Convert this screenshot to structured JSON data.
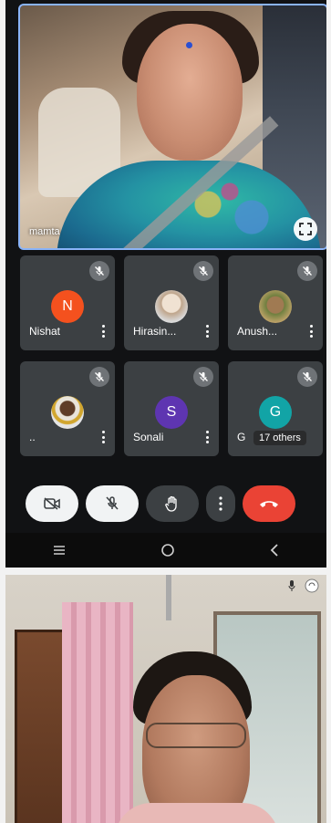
{
  "meeting": {
    "speaker": {
      "name": "mamta"
    },
    "participants": [
      {
        "name": "Nishat",
        "initial": "N",
        "avatar_type": "letter",
        "avatar_color": "#f4511e",
        "mic": "off"
      },
      {
        "name": "Hirasin...",
        "initial": "",
        "avatar_type": "photo1",
        "mic": "off"
      },
      {
        "name": "Anush...",
        "initial": "",
        "avatar_type": "photo2",
        "mic": "off"
      },
      {
        "name": "..",
        "initial": "",
        "avatar_type": "photo3",
        "mic": "off"
      },
      {
        "name": "Sonali",
        "initial": "S",
        "avatar_type": "letter",
        "avatar_color": "#5e35b1",
        "mic": "off"
      },
      {
        "name": "G",
        "initial": "G",
        "avatar_type": "letter",
        "avatar_color": "#12a4a6",
        "mic": "off",
        "others_label": "17 others"
      }
    ],
    "controls": [
      {
        "name": "camera-off-button",
        "icon": "video-off-icon"
      },
      {
        "name": "mic-off-button",
        "icon": "mic-off-icon"
      },
      {
        "name": "raise-hand-button",
        "icon": "hand-icon"
      },
      {
        "name": "more-options-button",
        "icon": "more-vert-icon"
      },
      {
        "name": "end-call-button",
        "icon": "phone-hangup-icon"
      }
    ],
    "colors": {
      "active_border": "#8ab4f8",
      "end_call": "#ea4335",
      "tile_bg": "#3c4043"
    }
  },
  "android_nav": {
    "buttons": [
      "recent-apps-icon",
      "home-icon",
      "back-icon"
    ]
  }
}
